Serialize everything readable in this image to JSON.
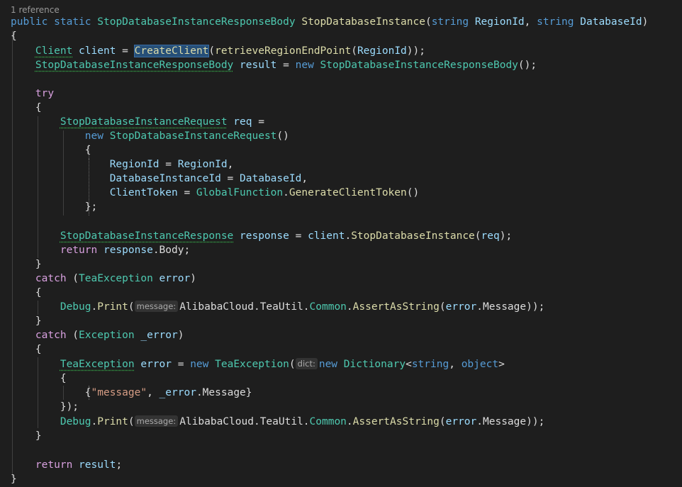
{
  "codelens": "1 reference",
  "hints": {
    "message": "message:",
    "dict": "dict:"
  },
  "t": {
    "public": "public",
    "static": "static",
    "string": "string",
    "new": "new",
    "try": "try",
    "catch": "catch",
    "return": "return",
    "object": "object",
    "respBodyType": "StopDatabaseInstanceResponseBody",
    "methodName": "StopDatabaseInstance",
    "regionId": "RegionId",
    "databaseId": "DatabaseId",
    "client": "Client",
    "clientVar": "client",
    "createClient": "CreateClient",
    "retrieve": "retrieveRegionEndPoint",
    "result": "result",
    "requestType": "StopDatabaseInstanceRequest",
    "req": "req",
    "dbInstanceId": "DatabaseInstanceId",
    "clientToken": "ClientToken",
    "globalFunction": "GlobalFunction",
    "genToken": "GenerateClientToken",
    "responseType": "StopDatabaseInstanceResponse",
    "response": "response",
    "body": "Body",
    "teaException": "TeaException",
    "error": "error",
    "debug": "Debug",
    "print": "Print",
    "alibaba": "AlibabaCloud",
    "teaUtil": "TeaUtil",
    "common": "Common",
    "assert": "AssertAsString",
    "messageProp": "Message",
    "exception": "Exception",
    "uerror": "_error",
    "dictionary": "Dictionary",
    "messageStr": "\"message\""
  }
}
